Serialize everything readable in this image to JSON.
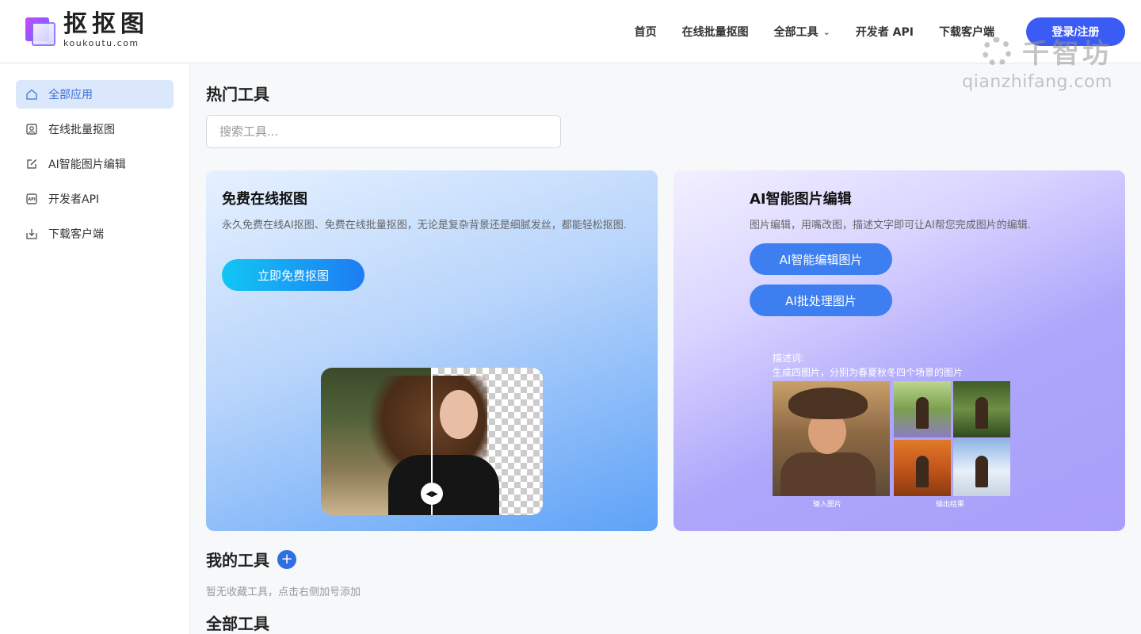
{
  "header": {
    "logo_cn": "抠抠图",
    "logo_en": "koukoutu.com",
    "nav": [
      {
        "label": "首页"
      },
      {
        "label": "在线批量抠图"
      },
      {
        "label": "全部工具",
        "has_dropdown": true
      },
      {
        "label": "开发者 API"
      },
      {
        "label": "下载客户端"
      }
    ],
    "login_label": "登录/注册",
    "accent": "#3b5bf5"
  },
  "watermark": {
    "cn": "千智坊",
    "en": "qianzhifang.com"
  },
  "sidebar": {
    "items": [
      {
        "label": "全部应用",
        "icon": "home-icon",
        "active": true
      },
      {
        "label": "在线批量抠图",
        "icon": "portrait-icon",
        "active": false
      },
      {
        "label": "AI智能图片编辑",
        "icon": "edit-icon",
        "active": false
      },
      {
        "label": "开发者API",
        "icon": "api-icon",
        "active": false
      },
      {
        "label": "下载客户端",
        "icon": "download-icon",
        "active": false
      }
    ]
  },
  "main": {
    "hot_title": "热门工具",
    "search_placeholder": "搜索工具...",
    "card_cutout": {
      "title": "免费在线抠图",
      "desc": "永久免费在线AI抠图、免费在线批量抠图，无论是复杂背景还是细腻发丝，都能轻松抠图.",
      "button": "立即免费抠图"
    },
    "card_ai_edit": {
      "title": "AI智能图片编辑",
      "desc": "图片编辑，用嘴改图，描述文字即可让AI帮您完成图片的编辑.",
      "button_edit": "AI智能编辑图片",
      "button_batch": "AI批处理图片",
      "prompt_label": "描述词:",
      "prompt_text": "生成四图片，分别为春夏秋冬四个场景的图片",
      "caption_input": "输入图片",
      "caption_output": "输出结果"
    },
    "my_tools_title": "我的工具",
    "my_tools_add": "+",
    "my_tools_empty": "暂无收藏工具，点击右侧加号添加",
    "all_tools_title": "全部工具"
  }
}
